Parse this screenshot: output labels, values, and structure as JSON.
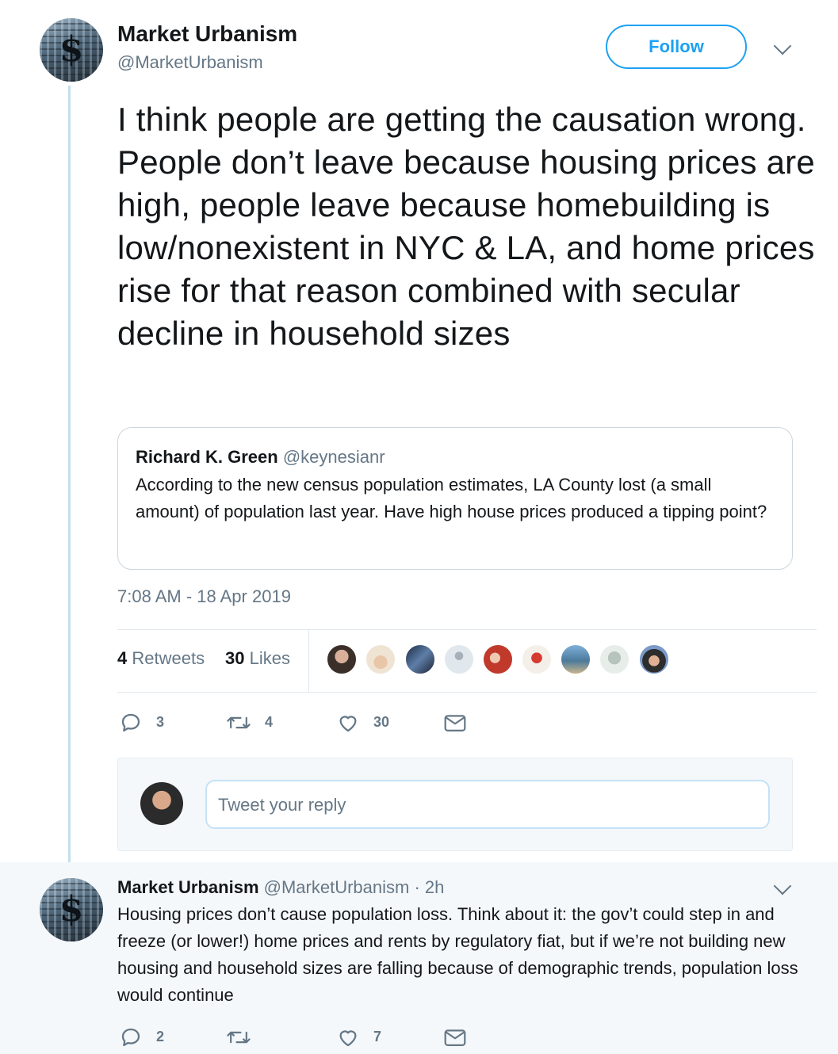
{
  "main_tweet": {
    "author_name": "Market Urbanism",
    "author_handle": "@MarketUrbanism",
    "follow_label": "Follow",
    "text": "I think people are getting the causation wrong. People don’t leave because housing prices are high, people leave because homebuilding is low/nonexistent in NYC & LA, and home prices rise for that reason combined with secular decline in household sizes",
    "quoted": {
      "author_name": "Richard K. Green",
      "author_handle": "@keynesianr",
      "text": "According to the new census population estimates, LA County lost (a small amount) of population last year.  Have high house prices produced a tipping point?"
    },
    "timestamp": "7:08 AM - 18 Apr 2019",
    "stats": {
      "retweets_count": "4",
      "retweets_label": "Retweets",
      "likes_count": "30",
      "likes_label": "Likes"
    },
    "actions": {
      "reply_count": "3",
      "retweet_count": "4",
      "like_count": "30"
    }
  },
  "reply_composer": {
    "placeholder": "Tweet your reply"
  },
  "reply_tweet": {
    "author_name": "Market Urbanism",
    "author_handle": "@MarketUrbanism",
    "time": "· 2h",
    "text": "Housing prices don’t cause population loss. Think about it: the gov’t could step in and freeze (or lower!) home prices and rents by regulatory fiat, but if we’re not building new housing and household sizes are falling because of demographic trends, population loss would continue",
    "actions": {
      "reply_count": "2",
      "retweet_count": "",
      "like_count": "7"
    }
  },
  "colors": {
    "accent": "#1da1f2",
    "muted": "#657786",
    "text": "#14171a",
    "border": "#e1e8ed"
  }
}
